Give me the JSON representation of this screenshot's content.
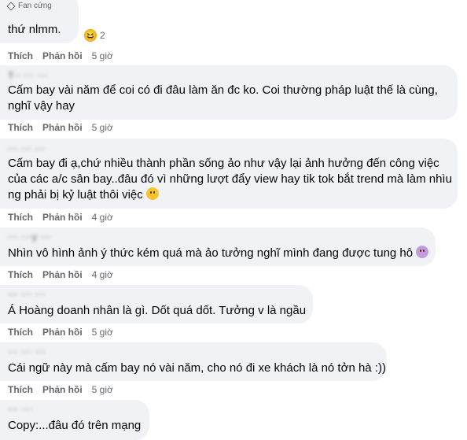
{
  "fan_badge": "Fan cứng",
  "comments": [
    {
      "author": "",
      "lines": [
        "thứ nlmm."
      ],
      "reaction_count": "2",
      "like": "Thích",
      "reply": "Phản hồi",
      "time": "5 giờ"
    },
    {
      "author": "T·· ··· ···",
      "lines": [
        "Cấm bay vài năm để coi có đi đâu làm ăn đc ko. Coi thường pháp luật thế là cùng,",
        "nghĩ vậy hay"
      ],
      "like": "Thích",
      "reply": "Phản hồi",
      "time": "5 giờ"
    },
    {
      "author": "··· ··· ···",
      "lines": [
        "Cấm bay đi ạ,chứ nhiều thành phần sống ảo như vậy lại ảnh hưởng đến công việc",
        "của các a/c sân bay..đâu đó vì những lượt đẩy view hay tik tok bắt trend mà làm nhìu",
        "ng phải bị kỷ luật thôi việc"
      ],
      "like": "Thích",
      "reply": "Phản hồi",
      "time": "4 giờ"
    },
    {
      "author": "··· ···y ···",
      "lines": [
        "Nhìn vô hình ảnh ý thức kém quá mà ảo tưởng nghĩ mình đang được tung hô"
      ],
      "like": "Thích",
      "reply": "Phản hồi",
      "time": "4 giờ"
    },
    {
      "author": "··· ··· ···",
      "lines": [
        "Á Hoàng doanh nhân là gì. Dốt quá dốt. Tưởng v là ngầu"
      ],
      "like": "Thích",
      "reply": "Phản hồi",
      "time": "5 giờ"
    },
    {
      "author": "··· ··· ···",
      "lines": [
        "Cái ngữ này mà cấm bay nó vài năm, cho nó đi xe khách là nó tởn hà :))"
      ],
      "like": "Thích",
      "reply": "Phản hồi",
      "time": "5 giờ"
    },
    {
      "author": "··· ···",
      "lines": [
        "Copy:...đâu đó trên mạng"
      ]
    }
  ]
}
